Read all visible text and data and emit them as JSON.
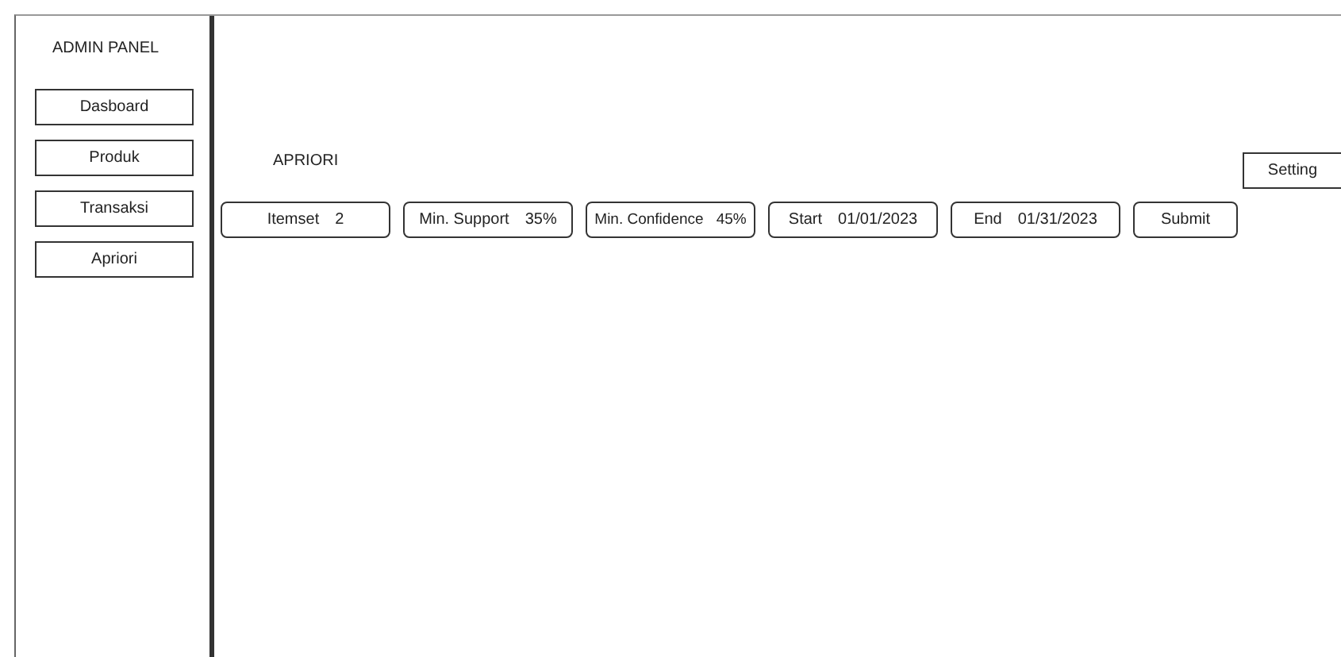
{
  "sidebar": {
    "title": "ADMIN PANEL",
    "items": [
      {
        "label": "Dasboard",
        "selected": false
      },
      {
        "label": "Produk",
        "selected": false
      },
      {
        "label": "Transaksi",
        "selected": false
      },
      {
        "label": "Apriori",
        "selected": false
      }
    ]
  },
  "page": {
    "title": "APRIORI",
    "setting_button": "Setting"
  },
  "filters": [
    {
      "label": "Itemset",
      "value": "2"
    },
    {
      "label": "Min. Support",
      "value": "35%"
    },
    {
      "label": "Min. Confidence",
      "value": "45%"
    },
    {
      "label": "Start",
      "value": "01/01/2023"
    },
    {
      "label": "End",
      "value": "01/31/2023"
    }
  ],
  "submit_button": "Submit"
}
